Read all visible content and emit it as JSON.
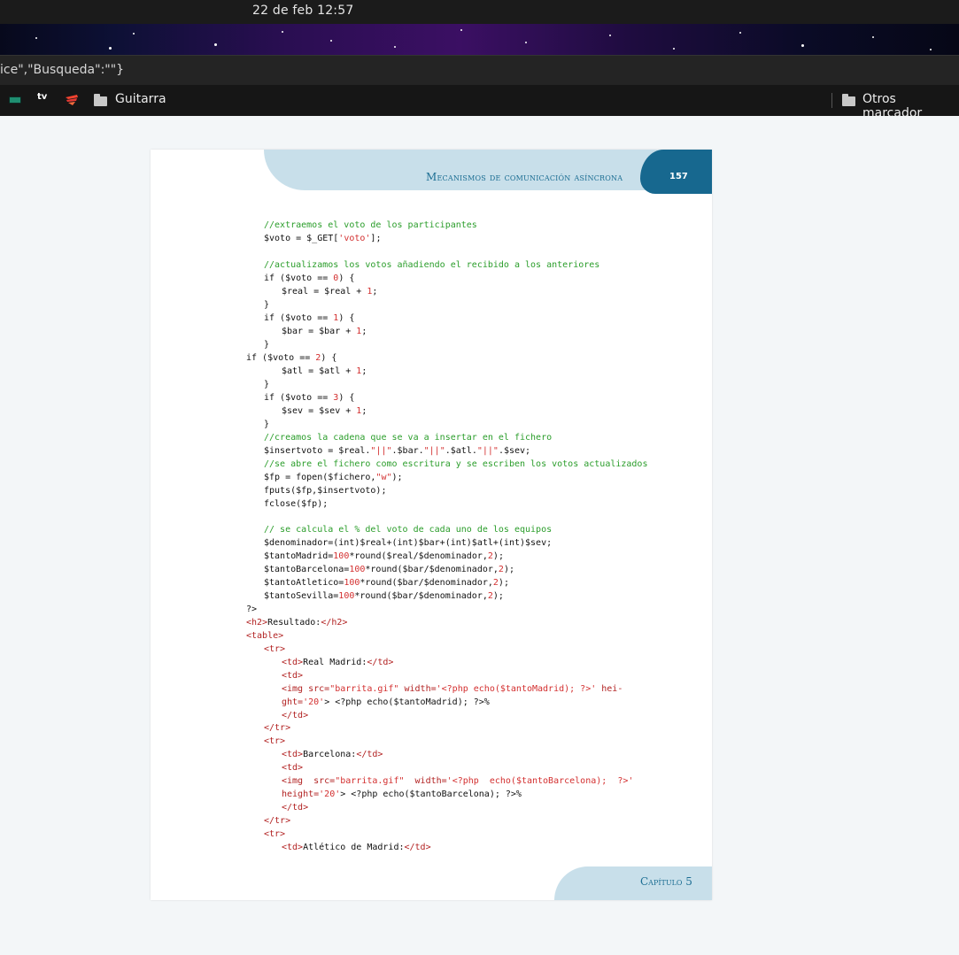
{
  "system": {
    "clock": "22 de feb  12:57"
  },
  "browser": {
    "url_fragment": "ice\",\"Busqueda\":\"\"}",
    "bookmarks": [
      {
        "icon": "filmin-icon",
        "label": "FILMIN"
      },
      {
        "icon": "apple-tv-icon",
        "label": "tv"
      },
      {
        "icon": "stadia-icon",
        "label": ""
      },
      {
        "icon": "folder-icon",
        "label": "Guitarra"
      }
    ],
    "other_bookmarks": "Otros marcador"
  },
  "page": {
    "header_title": "Mecanismos de comunicación asíncrona",
    "page_number": "157",
    "footer": "Capítulo 5",
    "accent": "#17688f",
    "band": "#c8dfea"
  },
  "code_lines": [
    {
      "id": "l1",
      "segs": [
        {
          "c": "//extraemos el voto de los participantes"
        }
      ]
    },
    {
      "id": "l2",
      "segs": [
        {
          "k": "$voto = $_GET["
        },
        {
          "r": "'voto'"
        },
        {
          "k": "];"
        }
      ]
    },
    {
      "id": "l3",
      "segs": [
        {
          "c": "//actualizamos los votos añadiendo el recibido a los anteriores"
        }
      ]
    },
    {
      "id": "l4",
      "segs": [
        {
          "k": "if ($voto == "
        },
        {
          "r": "0"
        },
        {
          "k": ") {"
        }
      ]
    },
    {
      "id": "l5",
      "segs": [
        {
          "k": "$real = $real + "
        },
        {
          "r": "1"
        },
        {
          "k": ";"
        }
      ]
    },
    {
      "id": "l6",
      "segs": [
        {
          "k": "}"
        }
      ]
    },
    {
      "id": "l7",
      "segs": [
        {
          "k": "if ($voto == "
        },
        {
          "r": "1"
        },
        {
          "k": ") {"
        }
      ]
    },
    {
      "id": "l8",
      "segs": [
        {
          "k": "$bar = $bar + "
        },
        {
          "r": "1"
        },
        {
          "k": ";"
        }
      ]
    },
    {
      "id": "l9",
      "segs": [
        {
          "k": "}"
        }
      ]
    },
    {
      "id": "l10",
      "segs": [
        {
          "k": "if ($voto == "
        },
        {
          "r": "2"
        },
        {
          "k": ") {"
        }
      ]
    },
    {
      "id": "l11",
      "segs": [
        {
          "k": "$atl = $atl + "
        },
        {
          "r": "1"
        },
        {
          "k": ";"
        }
      ]
    },
    {
      "id": "l12",
      "segs": [
        {
          "k": "}"
        }
      ]
    },
    {
      "id": "l13",
      "segs": [
        {
          "k": "if ($voto == "
        },
        {
          "r": "3"
        },
        {
          "k": ") {"
        }
      ]
    },
    {
      "id": "l14",
      "segs": [
        {
          "k": "$sev = $sev + "
        },
        {
          "r": "1"
        },
        {
          "k": ";"
        }
      ]
    },
    {
      "id": "l15",
      "segs": [
        {
          "k": "}"
        }
      ]
    },
    {
      "id": "l16",
      "segs": [
        {
          "c": "//creamos la cadena que se va a insertar en el fichero"
        }
      ]
    },
    {
      "id": "l17",
      "segs": [
        {
          "k": "$insertvoto = $real."
        },
        {
          "r": "\"||\""
        },
        {
          "k": ".$bar."
        },
        {
          "r": "\"||\""
        },
        {
          "k": ".$atl."
        },
        {
          "r": "\"||\""
        },
        {
          "k": ".$sev;"
        }
      ]
    },
    {
      "id": "l18",
      "segs": [
        {
          "c": "//se abre el fichero como escritura y se escriben los votos actualizados"
        }
      ]
    },
    {
      "id": "l19",
      "segs": [
        {
          "k": "$fp = fopen($fichero,"
        },
        {
          "r": "\"w\""
        },
        {
          "k": ");"
        }
      ]
    },
    {
      "id": "l20",
      "segs": [
        {
          "k": "fputs($fp,$insertvoto);"
        }
      ]
    },
    {
      "id": "l21",
      "segs": [
        {
          "k": "fclose($fp);"
        }
      ]
    },
    {
      "id": "l22",
      "segs": [
        {
          "c": "// se calcula el % del voto de cada uno de los equipos"
        }
      ]
    },
    {
      "id": "l23",
      "segs": [
        {
          "k": "$denominador=(int)$real+(int)$bar+(int)$atl+(int)$sev;"
        }
      ]
    },
    {
      "id": "l24",
      "segs": [
        {
          "k": "$tantoMadrid="
        },
        {
          "r": "100"
        },
        {
          "k": "*round($real/$denominador,"
        },
        {
          "r": "2"
        },
        {
          "k": ");"
        }
      ]
    },
    {
      "id": "l25",
      "segs": [
        {
          "k": "$tantoBarcelona="
        },
        {
          "r": "100"
        },
        {
          "k": "*round($bar/$denominador,"
        },
        {
          "r": "2"
        },
        {
          "k": ");"
        }
      ]
    },
    {
      "id": "l26",
      "segs": [
        {
          "k": "$tantoAtletico="
        },
        {
          "r": "100"
        },
        {
          "k": "*round($bar/$denominador,"
        },
        {
          "r": "2"
        },
        {
          "k": ");"
        }
      ]
    },
    {
      "id": "l27",
      "segs": [
        {
          "k": "$tantoSevilla="
        },
        {
          "r": "100"
        },
        {
          "k": "*round($bar/$denominador,"
        },
        {
          "r": "2"
        },
        {
          "k": ");"
        }
      ]
    },
    {
      "id": "l28",
      "segs": [
        {
          "k": "?>"
        }
      ]
    },
    {
      "id": "l29",
      "segs": [
        {
          "t": "<h2>"
        },
        {
          "k": "Resultado:"
        },
        {
          "t": "</h2>"
        }
      ]
    },
    {
      "id": "l30",
      "segs": [
        {
          "t": "<table>"
        }
      ]
    },
    {
      "id": "l31",
      "segs": [
        {
          "t": "<tr>"
        }
      ]
    },
    {
      "id": "l32",
      "segs": [
        {
          "t": "<td>"
        },
        {
          "k": "Real Madrid:"
        },
        {
          "t": "</td>"
        }
      ]
    },
    {
      "id": "l33",
      "segs": [
        {
          "t": "<td>"
        }
      ]
    },
    {
      "id": "l34",
      "segs": [
        {
          "t": "<img src="
        },
        {
          "r": "\"barrita.gif\""
        },
        {
          "t": " width="
        },
        {
          "r": "'<?php echo($tantoMadrid); ?>'"
        },
        {
          "t": " hei-"
        }
      ]
    },
    {
      "id": "l35",
      "segs": [
        {
          "t": "ght="
        },
        {
          "r": "'20'"
        },
        {
          "k": "> <?php echo($tantoMadrid); ?>%"
        }
      ]
    },
    {
      "id": "l36",
      "segs": [
        {
          "t": "</td>"
        }
      ]
    },
    {
      "id": "l37",
      "segs": [
        {
          "t": "</tr>"
        }
      ]
    },
    {
      "id": "l38",
      "segs": [
        {
          "t": "<tr>"
        }
      ]
    },
    {
      "id": "l39",
      "segs": [
        {
          "t": "<td>"
        },
        {
          "k": "Barcelona:"
        },
        {
          "t": "</td>"
        }
      ]
    },
    {
      "id": "l40",
      "segs": [
        {
          "t": "<td>"
        }
      ]
    },
    {
      "id": "l41",
      "segs": [
        {
          "t": "<img  src="
        },
        {
          "r": "\"barrita.gif\""
        },
        {
          "t": "  width="
        },
        {
          "r": "'<?php  echo($tantoBarcelona);  ?>'"
        }
      ]
    },
    {
      "id": "l42",
      "segs": [
        {
          "t": "height="
        },
        {
          "r": "'20'"
        },
        {
          "k": "> <?php echo($tantoBarcelona); ?>%"
        }
      ]
    },
    {
      "id": "l43",
      "segs": [
        {
          "t": "</td>"
        }
      ]
    },
    {
      "id": "l44",
      "segs": [
        {
          "t": "</tr>"
        }
      ]
    },
    {
      "id": "l45",
      "segs": [
        {
          "t": "<tr>"
        }
      ]
    },
    {
      "id": "l46",
      "segs": [
        {
          "t": "<td>"
        },
        {
          "k": "Atlético de Madrid:"
        },
        {
          "t": "</td>"
        }
      ]
    }
  ]
}
